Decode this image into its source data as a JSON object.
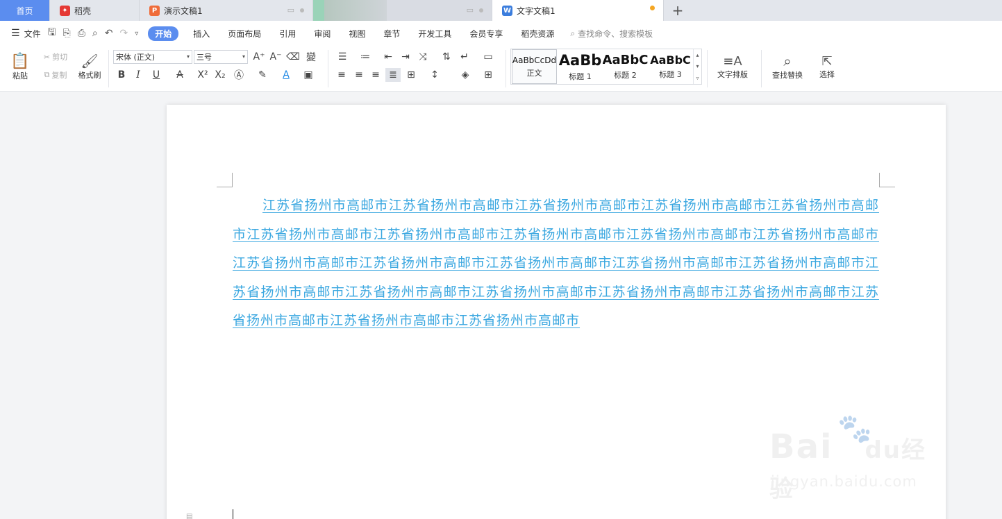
{
  "tabs": {
    "home": "首页",
    "daoke": "稻壳",
    "ppt": "演示文稿1",
    "doc": "文字文稿1",
    "new_tab": "+"
  },
  "menu": {
    "file": "文件",
    "items": [
      "开始",
      "插入",
      "页面布局",
      "引用",
      "审阅",
      "视图",
      "章节",
      "开发工具",
      "会员专享",
      "稻壳资源"
    ],
    "search": "查找命令、搜索模板"
  },
  "ribbon": {
    "paste": "粘贴",
    "cut": "剪切",
    "copy": "复制",
    "format_painter": "格式刷",
    "font_name": "宋体 (正文)",
    "font_size": "三号",
    "styles": [
      {
        "sample": "AaBbCcDd",
        "name": "正文"
      },
      {
        "sample": "AaBb",
        "name": "标题 1"
      },
      {
        "sample": "AaBbC",
        "name": "标题 2"
      },
      {
        "sample": "AaBbC",
        "name": "标题 3"
      }
    ],
    "text_layout": "文字排版",
    "find_replace": "查找替换",
    "select": "选择"
  },
  "document": {
    "paragraph": "江苏省扬州市高邮市江苏省扬州市高邮市江苏省扬州市高邮市江苏省扬州市高邮市江苏省扬州市高邮市江苏省扬州市高邮市江苏省扬州市高邮市江苏省扬州市高邮市江苏省扬州市高邮市江苏省扬州市高邮市江苏省扬州市高邮市江苏省扬州市高邮市江苏省扬州市高邮市江苏省扬州市高邮市江苏省扬州市高邮市江苏省扬州市高邮市江苏省扬州市高邮市江苏省扬州市高邮市江苏省扬州市高邮市江苏省扬州市高邮市江苏省扬州市高邮市江苏省扬州市高邮市江苏省扬州市高邮市"
  },
  "watermark": {
    "brand": "Bai",
    "brand2": "du",
    "cn": "经验",
    "url": "jingyan.baidu.com"
  },
  "colors": {
    "accent": "#5b8def",
    "link_text": "#3aa7e0",
    "unsaved_dot": "#f5a623"
  }
}
